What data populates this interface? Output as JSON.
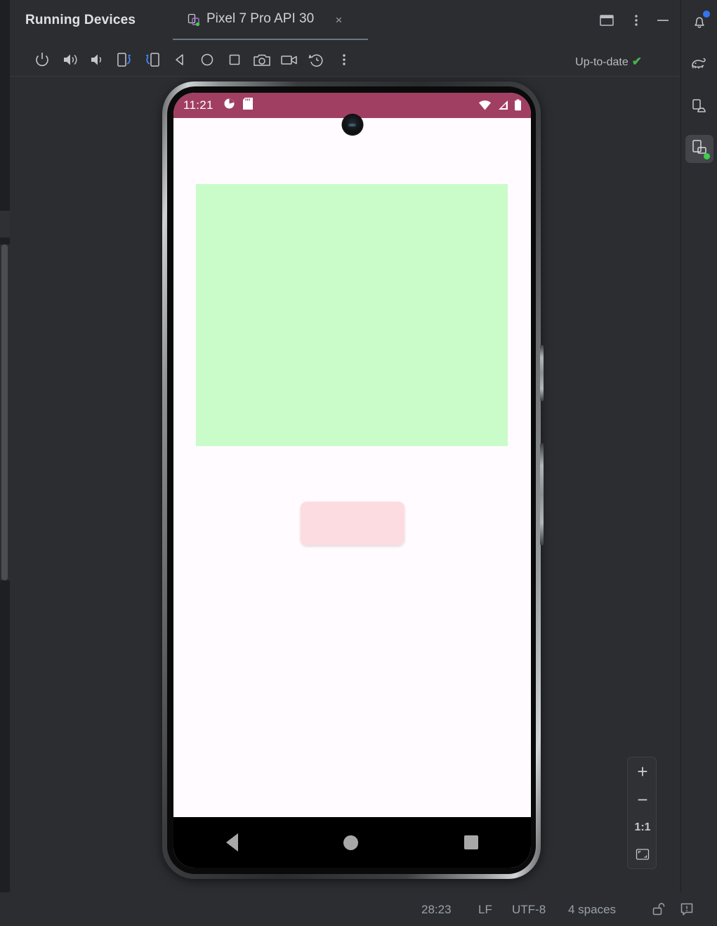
{
  "window": {
    "title": "Running Devices",
    "tab": {
      "label": "Pixel 7 Pro API 30",
      "icon": "device-tab-icon",
      "close_label": "×"
    },
    "controls": [
      {
        "name": "split-window-button",
        "icon": "window-split-icon"
      },
      {
        "name": "more-options-button",
        "icon": "vertical-dots-icon"
      },
      {
        "name": "minimize-button",
        "icon": "minimize-icon"
      }
    ]
  },
  "toolbar": {
    "buttons": [
      {
        "name": "power-button",
        "icon": "power-icon"
      },
      {
        "name": "volume-up-button",
        "icon": "volume-up-icon"
      },
      {
        "name": "volume-down-button",
        "icon": "volume-down-icon"
      },
      {
        "name": "rotate-left-button",
        "icon": "rotate-left-icon"
      },
      {
        "name": "rotate-right-button",
        "icon": "rotate-right-icon"
      },
      {
        "name": "back-button",
        "icon": "back-triangle-icon"
      },
      {
        "name": "home-button",
        "icon": "home-circle-icon"
      },
      {
        "name": "overview-button",
        "icon": "overview-square-icon"
      },
      {
        "name": "screenshot-button",
        "icon": "camera-icon"
      },
      {
        "name": "record-button",
        "icon": "video-camera-icon"
      },
      {
        "name": "restart-button",
        "icon": "history-restart-icon"
      },
      {
        "name": "toolbar-more-button",
        "icon": "vertical-dots-icon"
      }
    ],
    "status_label": "Up-to-date",
    "status_check": "✔",
    "status_color": "#4caf50"
  },
  "device": {
    "status_bar": {
      "time": "11:21",
      "left_icons": [
        "data-saver-icon",
        "sd-card-icon"
      ],
      "right_icons": [
        "wifi-icon",
        "cellular-signal-icon",
        "battery-icon"
      ],
      "background_color": "#a03f62"
    },
    "app": {
      "background_color": "#fffbff",
      "green_box_color": "#c9fcc9",
      "pink_box_color": "#fcdce1"
    },
    "nav_bar": {
      "buttons": [
        {
          "name": "android-back-button",
          "icon": "back-triangle-icon"
        },
        {
          "name": "android-home-button",
          "icon": "home-circle-icon"
        },
        {
          "name": "android-recents-button",
          "icon": "recents-square-icon"
        }
      ]
    }
  },
  "zoom_controls": {
    "zoom_in": "+",
    "zoom_out": "−",
    "actual_size": "1:1",
    "fit_label": "fit-to-screen-icon"
  },
  "right_strip": {
    "items": [
      {
        "name": "notifications-button",
        "icon": "bell-icon",
        "badge": true
      },
      {
        "name": "gradle-button",
        "icon": "elephant-icon",
        "badge": false
      },
      {
        "name": "device-manager-button",
        "icon": "device-android-icon",
        "badge": false
      },
      {
        "name": "running-devices-button",
        "icon": "running-device-icon",
        "badge": true,
        "selected": true
      }
    ]
  },
  "status_bar": {
    "caret_position": "28:23",
    "line_separator": "LF",
    "encoding": "UTF-8",
    "indent": "4 spaces",
    "lock_icon": "unlocked-icon",
    "notification_icon": "notification-balloon-icon"
  }
}
